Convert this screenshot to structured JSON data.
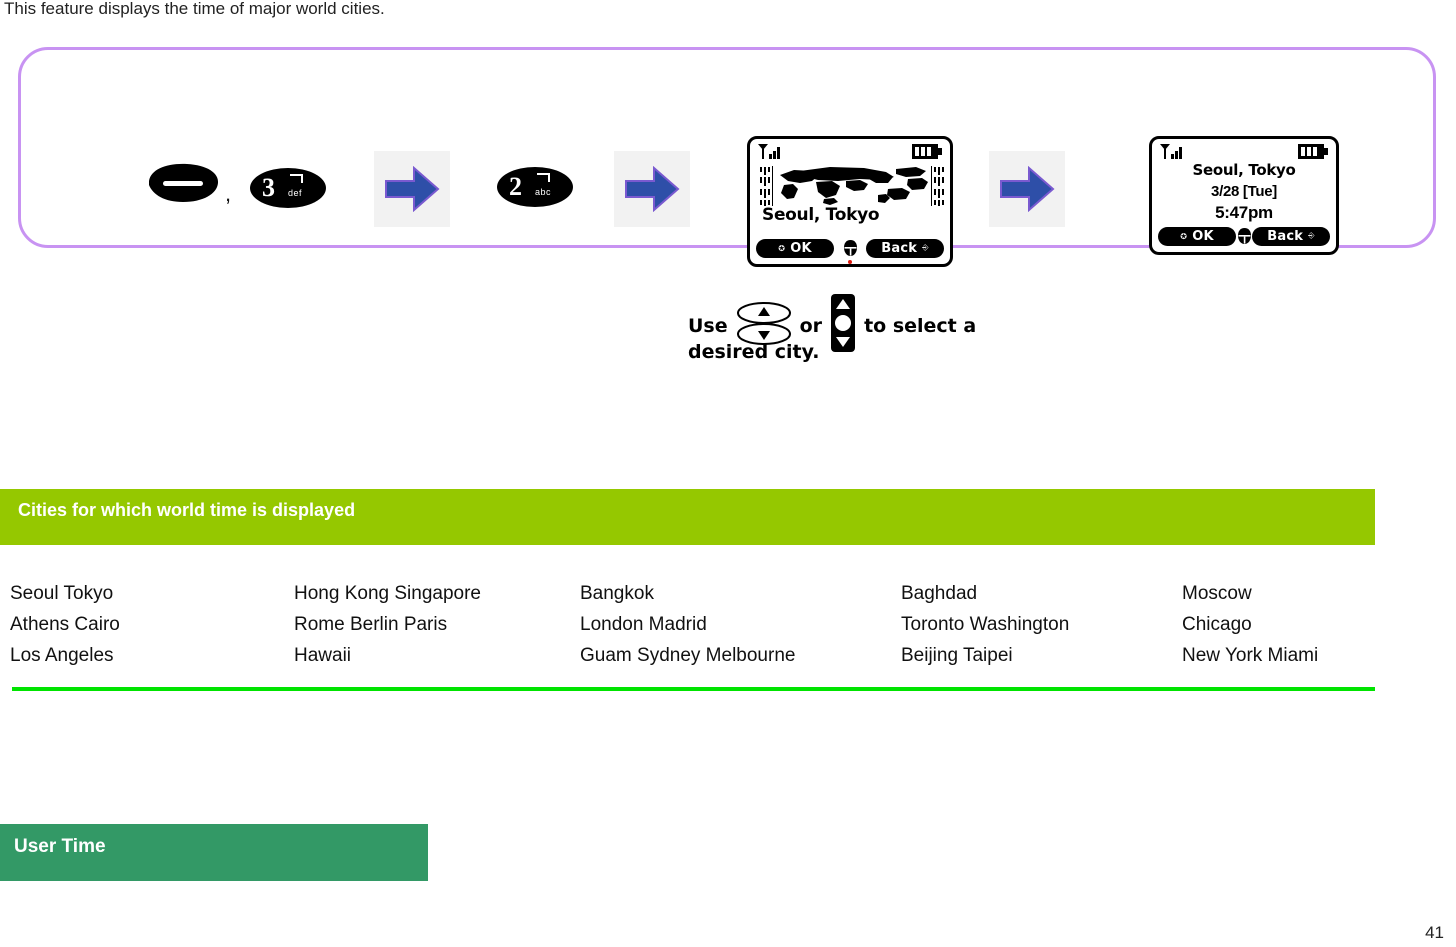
{
  "intro": {
    "text": "This feature displays the time of major world cities."
  },
  "steps": {
    "key_dash": {
      "icon": "dash-key-icon",
      "label": ""
    },
    "separator": ",",
    "key_3": {
      "digit": "3",
      "sub": "def"
    },
    "key_2": {
      "digit": "2",
      "sub": "abc"
    },
    "arrows": [
      "right-arrow-icon",
      "right-arrow-icon",
      "right-arrow-icon"
    ]
  },
  "phone_screen_1": {
    "signal_icon": "signal-bars-icon",
    "battery_icon": "battery-full-icon",
    "map_icon": "world-map-icon",
    "city": "Seoul, Tokyo",
    "softkey_left": "OK",
    "softkey_right": "Back",
    "nav_icon": "navigation-key-icon"
  },
  "phone_screen_2": {
    "signal_icon": "signal-bars-icon",
    "battery_icon": "battery-full-icon",
    "city": "Seoul, Tokyo",
    "date": "3/28 [Tue]",
    "time": "5:47pm",
    "softkey_left": "OK",
    "softkey_right": "Back",
    "nav_icon": "navigation-key-icon"
  },
  "instruction": {
    "word_use": "Use",
    "word_or": "or",
    "tail": "to select a",
    "line2": "desired city.",
    "rocker_icon": "up-down-rocker-key-icon",
    "navpad_icon": "navigation-pad-icon"
  },
  "sections": {
    "cities_header": "Cities for which world time is displayed",
    "user_time_header": "User Time"
  },
  "colors": {
    "green_header": "#95c800",
    "green_rule": "#00e400",
    "teal_header": "#339966",
    "purple_border": "#c893f2",
    "arrow_blue": "#2e4fa8"
  },
  "city_columns": [
    {
      "rows": [
        "Seoul   Tokyo",
        "Athens   Cairo",
        "Los Angeles"
      ]
    },
    {
      "rows": [
        "Hong Kong   Singapore",
        "Rome   Berlin   Paris",
        "Hawaii"
      ]
    },
    {
      "rows": [
        "Bangkok",
        "London   Madrid",
        "Guam   Sydney   Melbourne"
      ]
    },
    {
      "rows": [
        "Baghdad",
        "Toronto   Washington",
        "Beijing   Taipei"
      ]
    },
    {
      "rows": [
        "Moscow",
        "Chicago",
        "New York   Miami"
      ]
    }
  ],
  "footer": {
    "page_number": "41"
  }
}
